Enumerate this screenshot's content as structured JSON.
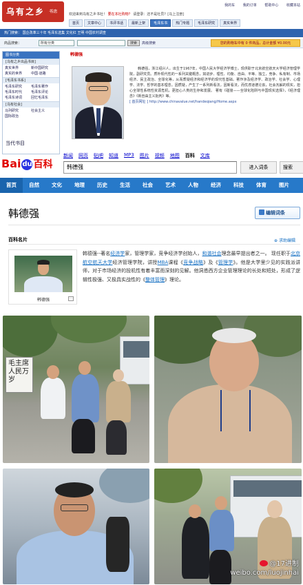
{
  "top_site": {
    "logo_main": "乌有之乡",
    "logo_sub": "书店",
    "welcome_text": "欢迎来到乌有之乡书社！",
    "welcome_red": "要在本社购物？",
    "welcome_tail": "请登录：还不是社员？[马上注册]",
    "top_links": [
      "我的车",
      "我的订单",
      "帮助中心",
      "收藏本站"
    ],
    "cat_nav": [
      "首页",
      "文章中心",
      "书评书话",
      "最新上架",
      "毛泽东书",
      "热门专题",
      "毛泽东研究",
      "真实世界"
    ],
    "cat_nav_active": "毛泽东书",
    "hot_bar": "热门搜索： 国企改革三十年  毛泽东选集  文化红  王明  中国农村调查",
    "search_label": "商品搜索：",
    "search_select": "所有分类",
    "search_button": "搜索",
    "search_advanced": "高级搜索",
    "notice": "您的购物车中有 0 件商品，总计金额 ¥0.00元"
  },
  "left_column": {
    "header": "图书分类",
    "groups": [
      {
        "title": "[乌有之乡出品书目]",
        "items": [
          "真实世界",
          "新中国研究",
          "真实的世界",
          "中国·道路"
        ]
      },
      {
        "title": "[毛泽东书系]",
        "items": [
          "毛泽东研究",
          "毛泽东著作",
          "毛泽东时代",
          "毛泽东评论",
          "毛泽东诗词",
          "回忆毛泽东"
        ]
      },
      {
        "title": "[乌有社会]",
        "items": [
          "马列研究",
          "社会主义",
          "国际政治"
        ]
      }
    ],
    "big_title": "当代书目"
  },
  "article": {
    "title": "韩德强",
    "body": "韩德强，浙江绍兴人，出生于1967年，中国人民大学经济学博士。现供职于北京航空航天大学经济管理学院，副研究员。质朴现代性的一系列关键概念，如进步、理性、均衡、自由、平等、独立，竞争、私有制、市场经济、民主政治、全球化等，从而质疑经济和经济学的现代性基础。著作涉及经济学、政治学、社会学、心理学、法学、哲学的基本理念。因质疑，产生了一系列新看法，因新看法，而优虑道德沦丧，社会瓦解的现实，担心全球性系统性资源危机，更担心人类的生存和发展。 著有《碰撞——全球化陷阱与中国现实选择》，《经济理念》《新自由主义批判》等。",
    "source": "[ 首页网址 ] http://www.chinavalue.net/handeqiang/Home.aspx"
  },
  "baidu": {
    "nav": [
      "新闻",
      "网页",
      "贴吧",
      "知道",
      "MP3",
      "图片",
      "视频",
      "地图",
      "百科",
      "文库"
    ],
    "nav_current": "百科",
    "logo_text_a": "Bai",
    "logo_paw": "du",
    "logo_text_b": "百科",
    "search_value": "韩德强",
    "enter_button": "进入词条",
    "search_button": "搜索",
    "categories": [
      "首页",
      "自然",
      "文化",
      "地理",
      "历史",
      "生活",
      "社会",
      "艺术",
      "人物",
      "经济",
      "科技",
      "体育",
      "图片"
    ],
    "entry_title": "韩德强",
    "edit_button": "编辑词条",
    "card_title": "百科名片",
    "help_link": "求助编辑",
    "thumb_caption": "韩德强",
    "summary_parts": [
      {
        "t": "韩德强--著名",
        "link": false
      },
      {
        "t": "经济学",
        "link": true
      },
      {
        "t": "家，管理学家，竞争经济学创始人，",
        "link": false
      },
      {
        "t": "和谐社会",
        "link": true
      },
      {
        "t": "理念最早提出者之一。 现任职于",
        "link": false
      },
      {
        "t": "北京航空航天大学",
        "link": true
      },
      {
        "t": "经济管理学院，讲授",
        "link": false
      },
      {
        "t": "MBA",
        "link": true
      },
      {
        "t": "课程《",
        "link": false
      },
      {
        "t": "竞争战略",
        "link": true
      },
      {
        "t": "》及《",
        "link": false
      },
      {
        "t": "管理学",
        "link": true
      },
      {
        "t": "》。他是大学里少见的实践派讲师，对于市场经济的投机性有着丰富而深刻的见解。他洞悉西方企业管理理论的长处和短处，形成了逻辑性极强、又极具实战性的《",
        "link": false
      },
      {
        "t": "整体管理",
        "link": true
      },
      {
        "t": "》理论。",
        "link": false
      }
    ]
  },
  "photos": {
    "banner_text": "毛主席人民万岁",
    "watermark_handle": "@17进制",
    "watermark_url": "weibo.com/luojinhai"
  },
  "colors": {
    "baidu_blue": "#2779c9",
    "baidu_red": "#e10602",
    "link_blue": "#136ec2",
    "site_blue": "#3a73c0",
    "site_red": "#c62f24"
  }
}
